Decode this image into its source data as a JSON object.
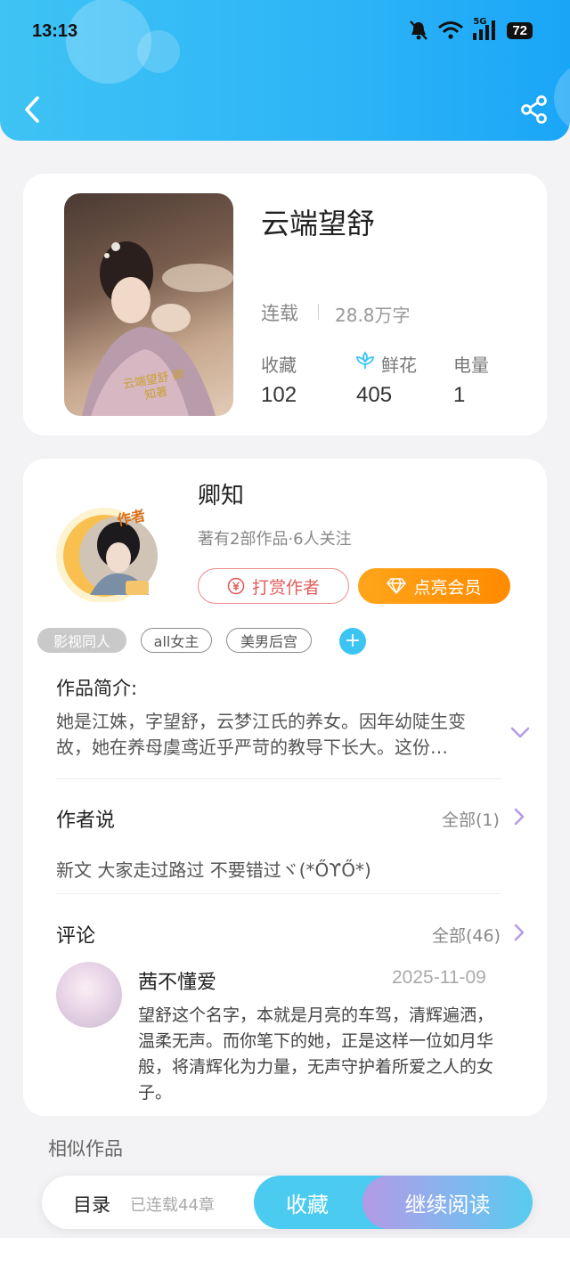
{
  "status_bar": {
    "time": "13:13",
    "network": "5G",
    "battery": "72"
  },
  "colors": {
    "accent": "#2db4f7",
    "vip": "#ff8a00",
    "tip": "#e45c5c",
    "chevron": "#b79ae6"
  },
  "book": {
    "title": "云端望舒",
    "status": "连载",
    "word_count": "28.8万字",
    "cover_text": "云端望舒 卿知著",
    "stats": [
      {
        "label": "收藏",
        "value": "102"
      },
      {
        "label": "鲜花",
        "value": "405"
      },
      {
        "label": "电量",
        "value": "1"
      }
    ]
  },
  "author": {
    "name": "卿知",
    "badge": "作者",
    "info": "著有2部作品·6人关注",
    "tip_button": "打赏作者",
    "vip_button": "点亮会员"
  },
  "tags": [
    "影视同人",
    "all女主",
    "美男后宫"
  ],
  "synopsis": {
    "title": "作品简介:",
    "text": "她是江姝，字望舒，云梦江氏的养女。因年幼陡生变故，她在养母虞鸢近乎严苛的教导下长大。这份…"
  },
  "author_says": {
    "title": "作者说",
    "more": "全部(1)",
    "text": "新文 大家走过路过 不要错过ヾ(*ŐϒŐ*)"
  },
  "comments": {
    "title": "评论",
    "more": "全部(46)",
    "items": [
      {
        "user": "茜不懂爱",
        "date": "2025-11-09",
        "text": "望舒这个名字，本就是月亮的车驾，清辉遍洒，温柔无声。而你笔下的她，正是这样一位如月华般，将清辉化为力量，无声守护着所爱之人的女子。"
      }
    ]
  },
  "similar": {
    "title": "相似作品"
  },
  "bottom_bar": {
    "toc": "目录",
    "serial": "已连载44章",
    "collect": "收藏",
    "read": "继续阅读"
  }
}
